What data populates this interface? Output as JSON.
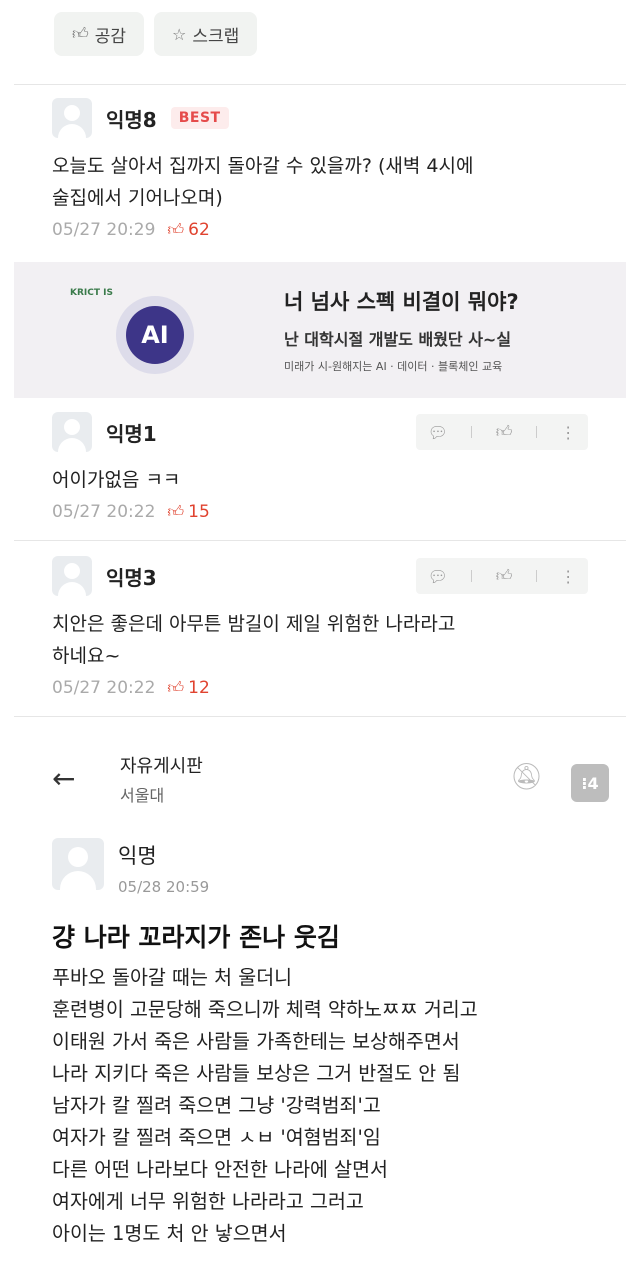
{
  "top_actions": {
    "like_label": "공감",
    "scrap_label": "스크랩"
  },
  "comments": [
    {
      "name": "익명8",
      "badge": "BEST",
      "text_lines": [
        "오늘도 살아서 집까지 돌아갈 수 있을까? (새벽 4시에",
        "술집에서 기어나오며)"
      ],
      "time": "05/27 20:29",
      "likes": "62"
    },
    {
      "name": "익명1",
      "text_lines": [
        "어이가없음 ㅋㅋ"
      ],
      "time": "05/27 20:22",
      "likes": "15"
    },
    {
      "name": "익명3",
      "text_lines": [
        "치안은 좋은데 아무튼 밤길이 제일 위험한 나라라고",
        "하네요~"
      ],
      "time": "05/27 20:22",
      "likes": "12"
    }
  ],
  "ad": {
    "logo_text": "KRICT IS",
    "badge": "AI",
    "title": "너 넘사 스펙 비결이 뭐야?",
    "subtitle": "난 대학시절 개발도 배웠단 사~실",
    "desc": "미래가 시-원해지는 AI · 데이터 · 블록체인 교육"
  },
  "post_header": {
    "board": "자유게시판",
    "school": "서울대",
    "more_label": "⁝4"
  },
  "post": {
    "author": "익명",
    "time": "05/28 20:59",
    "title": "걍 나라 꼬라지가 존나 웃김",
    "lines": [
      "푸바오 돌아갈 때는 처 울더니",
      "훈련병이 고문당해 죽으니까 체력 약하노ㅉㅉ 거리고",
      "이태원 가서 죽은 사람들 가족한테는 보상해주면서",
      "나라 지키다 죽은 사람들 보상은 그거 반절도 안 됨",
      "남자가 칼 찔려 죽으면 그냥 '강력범죄'고",
      "여자가 칼 찔려 죽으면 ㅅㅂ '여혐범죄'임",
      "다른 어떤 나라보다 안전한 나라에 살면서",
      "여자에게 너무 위험한 나라라고 그러고",
      "아이는 1명도 처 안 낳으면서"
    ]
  },
  "icons": {
    "like": "thumbs-up-icon",
    "scrap": "star-icon",
    "reply": "speech-bubble-icon",
    "more": "vertical-dots-icon",
    "back": "back-arrow-icon",
    "bell": "bell-off-icon"
  },
  "colors": {
    "like_red": "#e0432f",
    "best_red": "#e54b4b",
    "ad_purple": "#3d3588"
  }
}
